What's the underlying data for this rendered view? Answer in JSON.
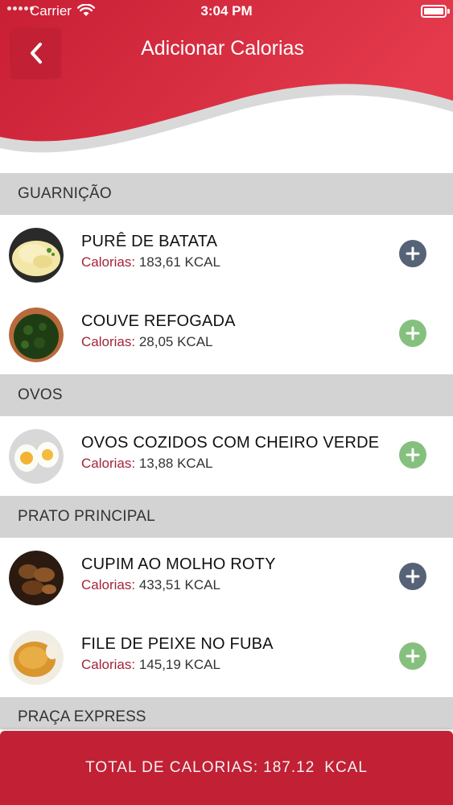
{
  "status_bar": {
    "carrier": "Carrier",
    "time": "3:04 PM"
  },
  "header": {
    "title": "Adicionar Calorias",
    "back_icon": "chevron-left-icon",
    "colors": {
      "primary": "#c22034",
      "gradient_end": "#e83347"
    }
  },
  "sections": [
    {
      "title": "GUARNIÇÃO",
      "items": [
        {
          "name": "PURÊ DE BATATA",
          "cal_label": "Calorias:",
          "cal_value": "183,61 KCAL",
          "button_state": "dark"
        },
        {
          "name": "COUVE REFOGADA",
          "cal_label": "Calorias:",
          "cal_value": "28,05 KCAL",
          "button_state": "green"
        }
      ]
    },
    {
      "title": "OVOS",
      "items": [
        {
          "name": "OVOS COZIDOS COM CHEIRO VERDE",
          "cal_label": "Calorias:",
          "cal_value": "13,88 KCAL",
          "button_state": "green"
        }
      ]
    },
    {
      "title": "PRATO PRINCIPAL",
      "items": [
        {
          "name": "CUPIM AO MOLHO ROTY",
          "cal_label": "Calorias:",
          "cal_value": "433,51 KCAL",
          "button_state": "dark"
        },
        {
          "name": "FILE DE PEIXE NO FUBA",
          "cal_label": "Calorias:",
          "cal_value": "145,19 KCAL",
          "button_state": "green"
        }
      ]
    },
    {
      "title": "PRAÇA EXPRESS",
      "items": []
    }
  ],
  "footer": {
    "label": "TOTAL DE CALORIAS:",
    "value": "187.12",
    "unit": "KCAL"
  }
}
